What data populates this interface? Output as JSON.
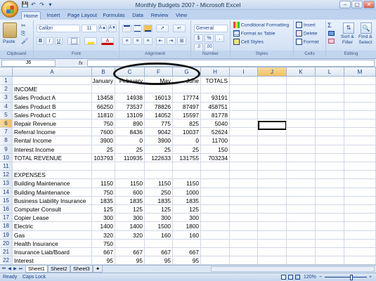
{
  "titlebar": {
    "title": "Monthly Budgets 2007 - Microsoft Excel",
    "minimize": "–",
    "maximize": "▢",
    "close": "✕"
  },
  "qat": {
    "save": "💾",
    "undo": "↶",
    "redo": "↷",
    "more": "▾"
  },
  "tabs": [
    "Home",
    "Insert",
    "Page Layout",
    "Formulas",
    "Data",
    "Review",
    "View"
  ],
  "ribbon": {
    "clipboard": {
      "label": "Clipboard",
      "paste": "Paste"
    },
    "font": {
      "label": "Font",
      "name": "Calibri",
      "size": "11",
      "grow": "A▲",
      "shrink": "A▼",
      "bold": "B",
      "italic": "I",
      "underline": "U",
      "font_color_glyph": "A"
    },
    "alignment": {
      "label": "Alignment"
    },
    "number": {
      "label": "Number",
      "format": "General",
      "currency": "$",
      "percent": "%",
      "comma": ","
    },
    "styles": {
      "label": "Styles",
      "conditional": "Conditional Formatting",
      "format_table": "Format as Table",
      "cell_styles": "Cell Styles"
    },
    "cells": {
      "label": "Cells",
      "insert": "Insert",
      "delete": "Delete",
      "format": "Format"
    },
    "editing": {
      "label": "Editing",
      "sigma": "Σ",
      "sort": "Sort &",
      "filter": "Filter",
      "find": "Find &",
      "select": "Select"
    }
  },
  "formula_bar": {
    "name_box": "J6",
    "fx": "fx",
    "value": ""
  },
  "columns": [
    "A",
    "B",
    "C",
    "F",
    "G",
    "H",
    "I",
    "J",
    "K",
    "L",
    "M"
  ],
  "selected_column": "J",
  "selected_row": "6",
  "active_cell": "J6",
  "rows": [
    {
      "n": "1",
      "a": "",
      "b": "January",
      "c": "February",
      "f": "May",
      "g": "June",
      "h": "TOTALS"
    },
    {
      "n": "2",
      "a": "INCOME",
      "b": "",
      "c": "",
      "f": "",
      "g": "",
      "h": ""
    },
    {
      "n": "3",
      "a": "Sales Product A",
      "b": "13458",
      "c": "14938",
      "f": "16013",
      "g": "17774",
      "h": "93191"
    },
    {
      "n": "4",
      "a": "Sales Product B",
      "b": "66250",
      "c": "73537",
      "f": "78826",
      "g": "87497",
      "h": "458751"
    },
    {
      "n": "5",
      "a": "Sales Product C",
      "b": "11810",
      "c": "13109",
      "f": "14052",
      "g": "15597",
      "h": "81778"
    },
    {
      "n": "6",
      "a": "Repair Revenue",
      "b": "750",
      "c": "890",
      "f": "775",
      "g": "825",
      "h": "5040"
    },
    {
      "n": "7",
      "a": "Referral Income",
      "b": "7600",
      "c": "8436",
      "f": "9042",
      "g": "10037",
      "h": "52624"
    },
    {
      "n": "8",
      "a": "Rental Income",
      "b": "3900",
      "c": "0",
      "f": "3900",
      "g": "0",
      "h": "11700"
    },
    {
      "n": "9",
      "a": "Interest Income",
      "b": "25",
      "c": "25",
      "f": "25",
      "g": "25",
      "h": "150"
    },
    {
      "n": "10",
      "a": "TOTAL REVENUE",
      "b": "103793",
      "c": "110935",
      "f": "122633",
      "g": "131755",
      "h": "703234"
    },
    {
      "n": "11",
      "a": "",
      "b": "",
      "c": "",
      "f": "",
      "g": "",
      "h": ""
    },
    {
      "n": "12",
      "a": "EXPENSES",
      "b": "",
      "c": "",
      "f": "",
      "g": "",
      "h": ""
    },
    {
      "n": "13",
      "a": "Building Maintenance",
      "b": "1150",
      "c": "1150",
      "f": "1150",
      "g": "1150",
      "h": ""
    },
    {
      "n": "14",
      "a": "Building Maintenance",
      "b": "750",
      "c": "600",
      "f": "250",
      "g": "1000",
      "h": ""
    },
    {
      "n": "15",
      "a": "Business Liability Insurance",
      "b": "1835",
      "c": "1835",
      "f": "1835",
      "g": "1835",
      "h": ""
    },
    {
      "n": "16",
      "a": "Computer Consult",
      "b": "125",
      "c": "125",
      "f": "125",
      "g": "125",
      "h": ""
    },
    {
      "n": "17",
      "a": "Copier Lease",
      "b": "300",
      "c": "300",
      "f": "300",
      "g": "300",
      "h": ""
    },
    {
      "n": "18",
      "a": "Electric",
      "b": "1400",
      "c": "1400",
      "f": "1500",
      "g": "1800",
      "h": ""
    },
    {
      "n": "19",
      "a": "Gas",
      "b": "320",
      "c": "320",
      "f": "160",
      "g": "160",
      "h": ""
    },
    {
      "n": "20",
      "a": "Health Insurance",
      "b": "750",
      "c": "",
      "f": "",
      "g": "",
      "h": ""
    },
    {
      "n": "21",
      "a": "Insurance Liab/Board",
      "b": "667",
      "c": "667",
      "f": "667",
      "g": "667",
      "h": ""
    },
    {
      "n": "22",
      "a": "Interest",
      "b": "95",
      "c": "95",
      "f": "95",
      "g": "95",
      "h": ""
    }
  ],
  "sheet_tabs": [
    "Sheet1",
    "Sheet2",
    "Sheet3"
  ],
  "active_sheet": "Sheet1",
  "status": {
    "ready": "Ready",
    "caps": "Caps Lock",
    "zoom": "120%",
    "zoom_out": "−",
    "zoom_in": "+"
  },
  "colors": {
    "accent": "#15428b",
    "ribbon": "#d5e3f5",
    "selection": "#f1c15f"
  }
}
